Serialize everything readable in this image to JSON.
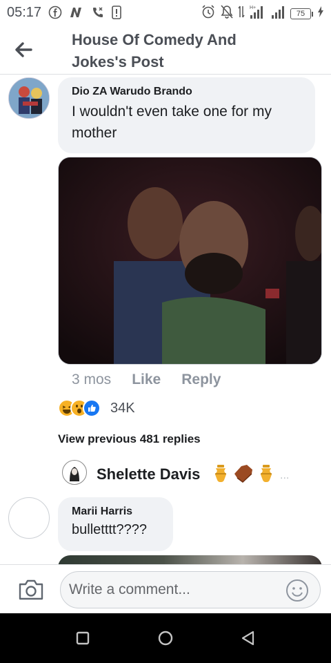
{
  "status_bar": {
    "time": "05:17",
    "network_badge": "H+",
    "battery": "75"
  },
  "header": {
    "title_line1": "House Of Comedy And",
    "title_line2": "Jokes's Post",
    "back_icon": "arrow-left-icon"
  },
  "comments": [
    {
      "author": "Dio ZA Warudo Brando",
      "text_line1": "I wouldn't even take one for my",
      "text_line2": "mother",
      "time": "3 mos",
      "like_label": "Like",
      "reply_label": "Reply",
      "reactions": [
        "haha",
        "wow",
        "like"
      ],
      "reaction_count": "34K",
      "view_previous": "View previous 481 replies",
      "latest_reply": {
        "name": "Shelette Davis",
        "emojis": [
          "urn",
          "coffin",
          "urn"
        ],
        "ellipsis": "..."
      }
    },
    {
      "author": "Marii Harris",
      "text": "bulletttt????"
    }
  ],
  "composer": {
    "placeholder": "Write a comment...",
    "camera_icon": "camera-icon",
    "emoji_icon": "smiley-icon"
  },
  "nav": {
    "recent_icon": "square-icon",
    "home_icon": "circle-icon",
    "back_icon": "triangle-back-icon"
  },
  "colors": {
    "text_primary": "#1c1e21",
    "text_secondary": "#8d949e",
    "bubble_bg": "#f0f2f5",
    "like_blue": "#1877f2",
    "reaction_yellow": "#f7b125"
  }
}
